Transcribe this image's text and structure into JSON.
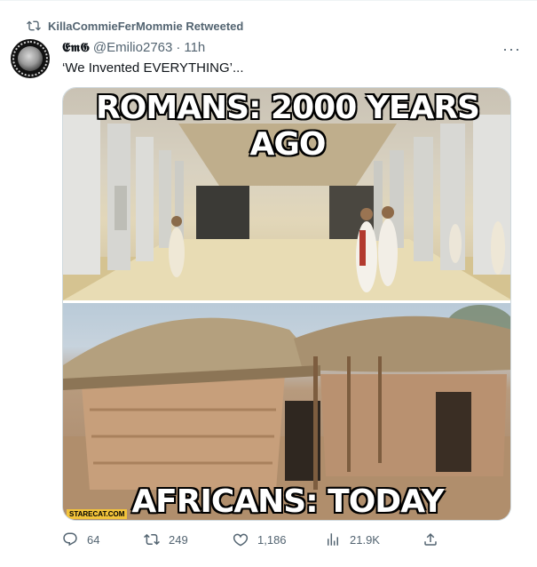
{
  "retweet_banner": {
    "text": "KillaCommieFerMommie Retweeted"
  },
  "author": {
    "display_name": "𝕰𝖒𝕲",
    "handle": "@Emilio2763",
    "separator": "·",
    "time": "11h"
  },
  "tweet": {
    "text": "‘We Invented EVERYTHING’..."
  },
  "media": {
    "top_caption": "ROMANS: 2000 YEARS AGO",
    "bottom_caption": "AFRICANS: TODAY",
    "watermark": "STARECAT.COM"
  },
  "actions": {
    "replies": "64",
    "retweets": "249",
    "likes": "1,186",
    "views": "21.9K"
  },
  "icons": [
    "retweet-icon",
    "more-icon",
    "reply-icon",
    "like-icon",
    "views-icon",
    "share-icon"
  ]
}
